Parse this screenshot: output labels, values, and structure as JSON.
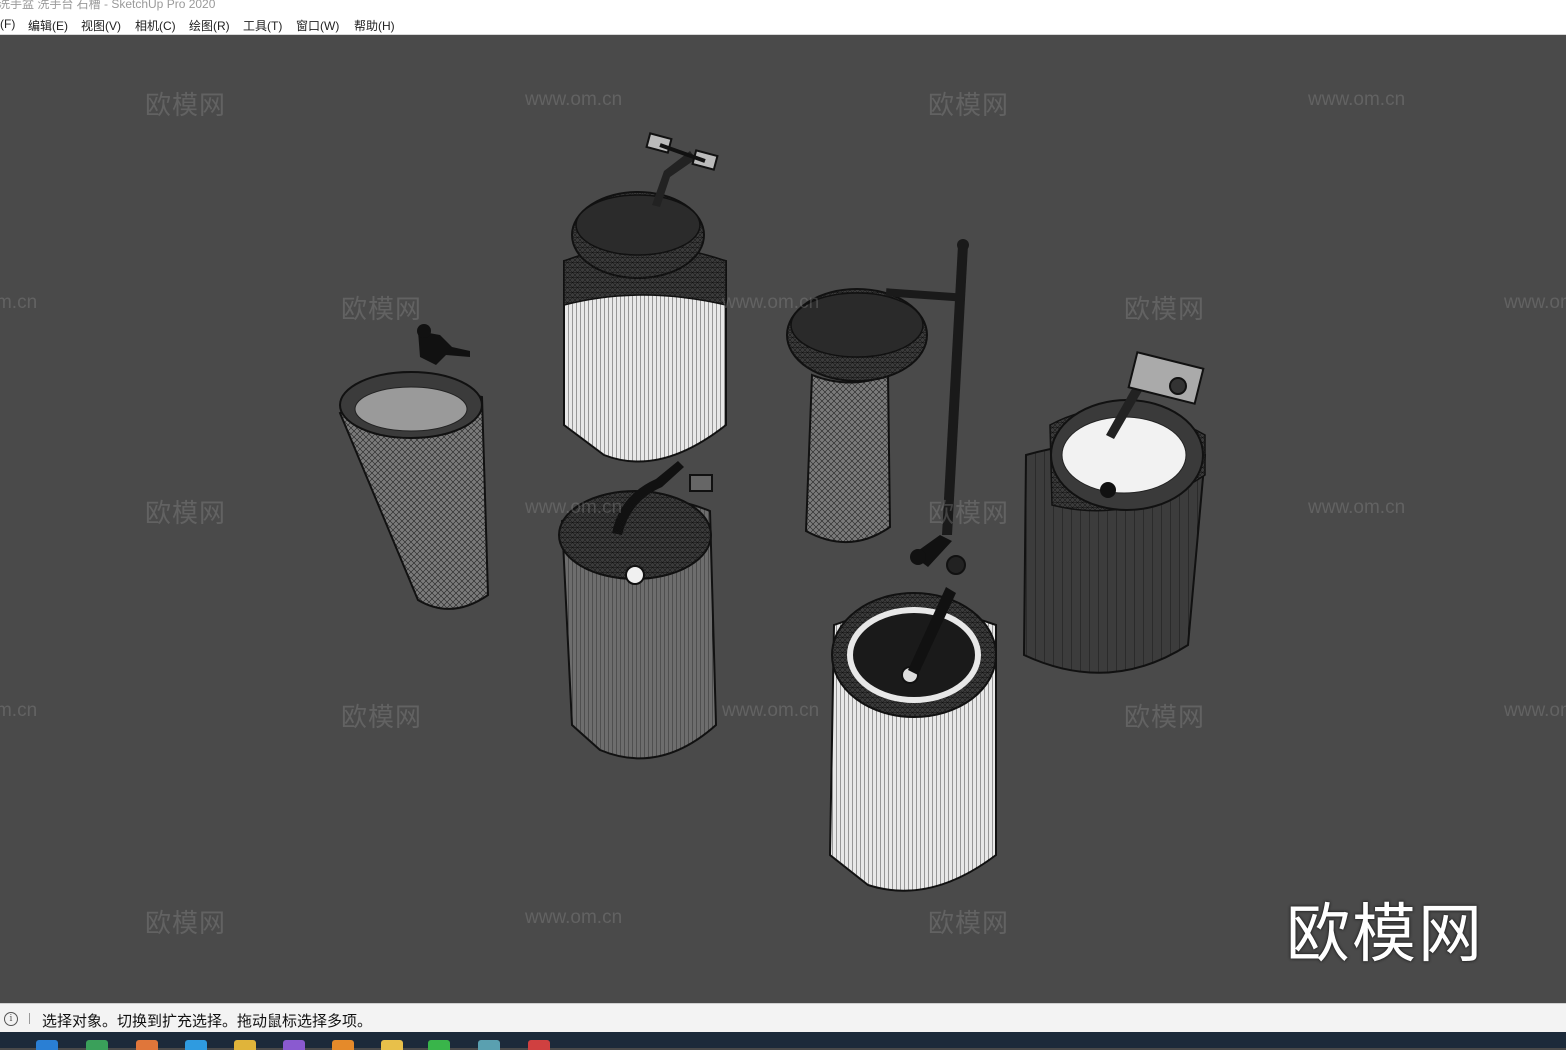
{
  "window": {
    "title": "洗手盆 洗手台 石槽 - SketchUp Pro 2020"
  },
  "menu": [
    {
      "label": "(F)"
    },
    {
      "label": "编辑(E)"
    },
    {
      "label": "视图(V)"
    },
    {
      "label": "相机(C)"
    },
    {
      "label": "绘图(R)"
    },
    {
      "label": "工具(T)"
    },
    {
      "label": "窗口(W)"
    },
    {
      "label": "帮助(H)"
    }
  ],
  "watermark": {
    "brand": "欧模网",
    "url": "www.om.cn"
  },
  "logo": "欧模网",
  "status": {
    "icon": "info-icon",
    "text": "选择对象。切换到扩充选择。拖动鼠标选择多项。"
  },
  "taskbar": {
    "icons": [
      {
        "name": "edge-icon",
        "color": "#2a7fd4"
      },
      {
        "name": "app-green-icon",
        "color": "#3aa05a"
      },
      {
        "name": "app-orange-icon",
        "color": "#e0763a"
      },
      {
        "name": "app-blue-icon",
        "color": "#2f9be0"
      },
      {
        "name": "app-yellow-icon",
        "color": "#e0b43a"
      },
      {
        "name": "app-purple-icon",
        "color": "#8a5ad0"
      },
      {
        "name": "app-orange2-icon",
        "color": "#e58a2a"
      },
      {
        "name": "folder-icon",
        "color": "#e8c04a"
      },
      {
        "name": "wechat-icon",
        "color": "#39b54a"
      },
      {
        "name": "app-teal-icon",
        "color": "#5aa0b0"
      },
      {
        "name": "sketchup-icon",
        "color": "#d04040"
      }
    ]
  }
}
